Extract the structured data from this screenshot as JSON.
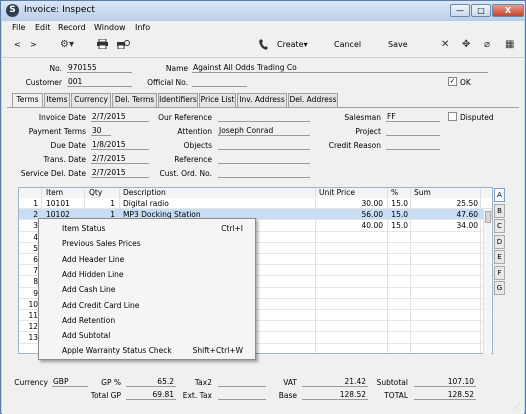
{
  "window": {
    "title": "Invoice: Inspect",
    "app_icon": "S",
    "buttons": [
      "—",
      "□",
      "X"
    ]
  },
  "menu": [
    "File",
    "Edit",
    "Record",
    "Window",
    "Info"
  ],
  "toolbar": {
    "back": "<",
    "forward": ">",
    "create": "Create",
    "cancel": "Cancel",
    "save": "Save",
    "icons": [
      "gear-icon",
      "print-icon",
      "print-preview-icon",
      "phone-icon",
      "close-icon",
      "expand-icon",
      "attachment-icon",
      "grid-icon"
    ]
  },
  "header": {
    "no_label": "No.",
    "no_value": "970155",
    "name_label": "Name",
    "name_value": "Against All Odds Trading Co",
    "customer_label": "Customer",
    "customer_value": "001",
    "official_label": "Official No.",
    "official_value": "",
    "ok_label": "OK",
    "ok_checked": "✓"
  },
  "tabs": [
    "Terms",
    "Items",
    "Currency",
    "Del. Terms",
    "Identifiers",
    "Price List",
    "Inv. Address",
    "Del. Address"
  ],
  "terms": {
    "invoice_date_label": "Invoice Date",
    "invoice_date": "2/7/2015",
    "payment_terms_label": "Payment Terms",
    "payment_terms": "30",
    "due_date_label": "Due Date",
    "due_date": "1/8/2015",
    "trans_date_label": "Trans. Date",
    "trans_date": "2/7/2015",
    "service_del_date_label": "Service Del. Date",
    "service_del_date": "2/7/2015",
    "our_reference_label": "Our Reference",
    "our_reference": "",
    "attention_label": "Attention",
    "attention": "Joseph Conrad",
    "objects_label": "Objects",
    "objects": "",
    "reference_label": "Reference",
    "reference": "",
    "cust_ord_label": "Cust. Ord. No.",
    "cust_ord": "",
    "salesman_label": "Salesman",
    "salesman": "FF",
    "project_label": "Project",
    "project": "",
    "credit_reason_label": "Credit Reason",
    "credit_reason": "",
    "disputed_label": "Disputed"
  },
  "grid": {
    "columns": [
      "Item",
      "Qty",
      "Description",
      "Unit Price",
      "%",
      "Sum"
    ],
    "rows": [
      {
        "n": "1",
        "item": "10101",
        "qty": "1",
        "desc": "Digital radio",
        "price": "30.00",
        "pct": "15.0",
        "sum": "25.50"
      },
      {
        "n": "2",
        "item": "10102",
        "qty": "1",
        "desc": "MP3 Docking Station",
        "price": "56.00",
        "pct": "15.0",
        "sum": "47.60"
      },
      {
        "n": "3",
        "item": "",
        "qty": "",
        "desc": "",
        "price": "40.00",
        "pct": "15.0",
        "sum": "34.00"
      },
      {
        "n": "4",
        "item": "",
        "qty": "",
        "desc": "",
        "price": "",
        "pct": "",
        "sum": ""
      },
      {
        "n": "5",
        "item": "",
        "qty": "",
        "desc": "",
        "price": "",
        "pct": "",
        "sum": ""
      },
      {
        "n": "6",
        "item": "",
        "qty": "",
        "desc": "",
        "price": "",
        "pct": "",
        "sum": ""
      },
      {
        "n": "7",
        "item": "",
        "qty": "",
        "desc": "",
        "price": "",
        "pct": "",
        "sum": ""
      },
      {
        "n": "8",
        "item": "",
        "qty": "",
        "desc": "",
        "price": "",
        "pct": "",
        "sum": ""
      },
      {
        "n": "9",
        "item": "",
        "qty": "",
        "desc": "",
        "price": "",
        "pct": "",
        "sum": ""
      },
      {
        "n": "10",
        "item": "",
        "qty": "",
        "desc": "",
        "price": "",
        "pct": "",
        "sum": ""
      },
      {
        "n": "11",
        "item": "",
        "qty": "",
        "desc": "",
        "price": "",
        "pct": "",
        "sum": ""
      },
      {
        "n": "12",
        "item": "",
        "qty": "",
        "desc": "",
        "price": "",
        "pct": "",
        "sum": ""
      },
      {
        "n": "13",
        "item": "",
        "qty": "",
        "desc": "",
        "price": "",
        "pct": "",
        "sum": ""
      }
    ],
    "side_tabs": [
      "A",
      "B",
      "C",
      "D",
      "E",
      "F",
      "G"
    ]
  },
  "context_menu": [
    {
      "label": "Item Status",
      "shortcut": "Ctrl+I"
    },
    {
      "label": "Previous Sales Prices",
      "shortcut": ""
    },
    {
      "label": "Add Header Line",
      "shortcut": ""
    },
    {
      "label": "Add Hidden Line",
      "shortcut": ""
    },
    {
      "label": "Add Cash Line",
      "shortcut": ""
    },
    {
      "label": "Add Credit Card Line",
      "shortcut": ""
    },
    {
      "label": "Add Retention",
      "shortcut": ""
    },
    {
      "label": "Add Subtotal",
      "shortcut": ""
    },
    {
      "label": "Apple Warranty Status Check",
      "shortcut": "Shift+Ctrl+W"
    }
  ],
  "footer": {
    "currency_label": "Currency",
    "currency": "GBP",
    "gp_pct_label": "GP %",
    "gp_pct": "65.2",
    "total_gp_label": "Total GP",
    "total_gp": "69.81",
    "tax2_label": "Tax2",
    "tax2": "",
    "ext_tax_label": "Ext. Tax",
    "ext_tax": "",
    "vat_label": "VAT",
    "vat": "21.42",
    "base_label": "Base",
    "base": "128.52",
    "subtotal_label": "Subtotal",
    "subtotal": "107.10",
    "total_label": "TOTAL",
    "total": "128.52"
  }
}
